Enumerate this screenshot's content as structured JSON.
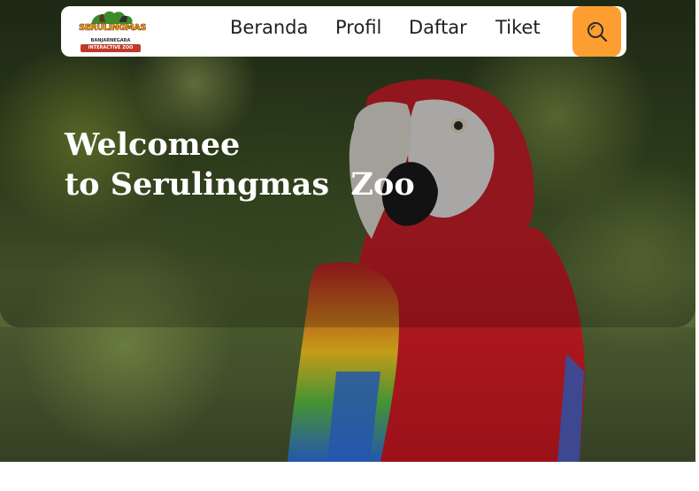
{
  "navbar": {
    "logo": {
      "title": "SERULINGMAS",
      "subtitle": "BANJARNEGARA",
      "tagline": "INTERACTIVE ZOO"
    },
    "links": [
      {
        "label": "Beranda"
      },
      {
        "label": "Profil"
      },
      {
        "label": "Daftar"
      },
      {
        "label": "Tiket"
      }
    ],
    "search_icon": "search-icon",
    "accent_color": "#ff9e30"
  },
  "hero": {
    "line1": "Welcomee",
    "line2": "to Serulingmas  Zoo",
    "image": "scarlet-macaw-parrot"
  }
}
